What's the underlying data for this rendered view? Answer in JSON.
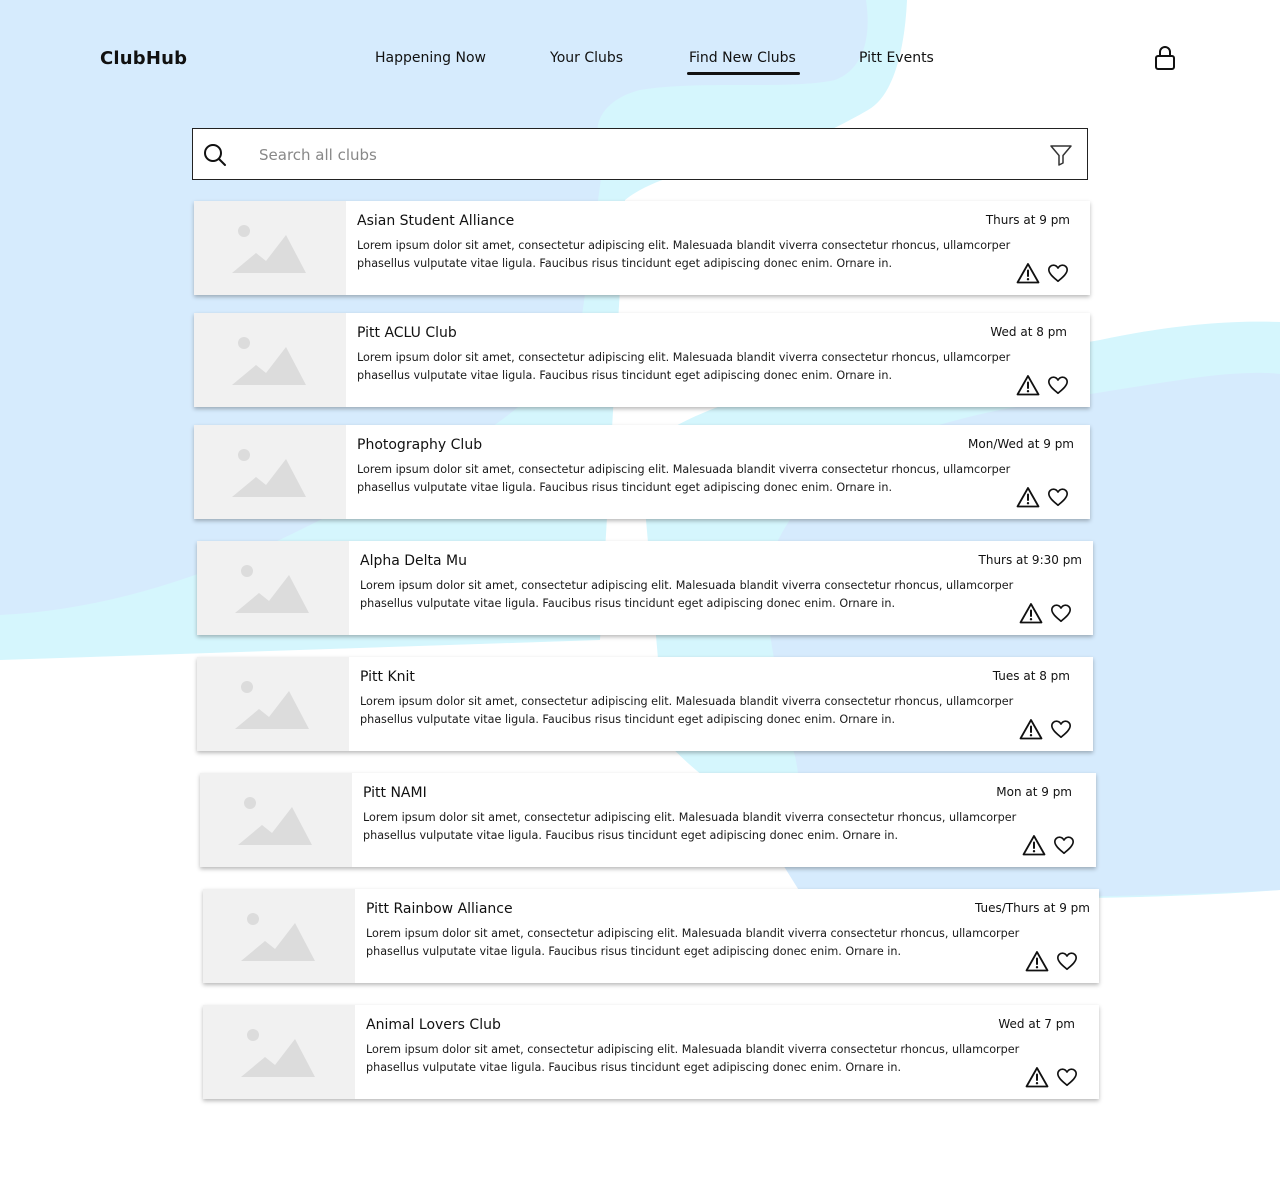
{
  "header": {
    "logo": "ClubHub",
    "nav": [
      {
        "label": "Happening Now",
        "active": false
      },
      {
        "label": "Your Clubs",
        "active": false
      },
      {
        "label": "Find New Clubs",
        "active": true
      },
      {
        "label": "Pitt Events",
        "active": false
      }
    ],
    "account_icon": "lock-icon"
  },
  "search": {
    "placeholder": "Search all clubs",
    "value": "",
    "icon": "search-icon",
    "filter_icon": "filter-icon"
  },
  "clubs": [
    {
      "name": "Asian Student Alliance",
      "meeting_time": "Thurs at 9 pm",
      "description": "Lorem ipsum dolor sit amet, consectetur adipiscing elit. Malesuada blandit viverra consectetur rhoncus, ullamcorper phasellus vulputate vitae ligula. Faucibus risus tincidunt eget adipiscing donec enim. Ornare in."
    },
    {
      "name": "Pitt ACLU Club",
      "meeting_time": "Wed at 8 pm",
      "description": "Lorem ipsum dolor sit amet, consectetur adipiscing elit. Malesuada blandit viverra consectetur rhoncus, ullamcorper phasellus vulputate vitae ligula. Faucibus risus tincidunt eget adipiscing donec enim. Ornare in."
    },
    {
      "name": "Photography Club",
      "meeting_time": "Mon/Wed at 9 pm",
      "description": "Lorem ipsum dolor sit amet, consectetur adipiscing elit. Malesuada blandit viverra consectetur rhoncus, ullamcorper phasellus vulputate vitae ligula. Faucibus risus tincidunt eget adipiscing donec enim. Ornare in."
    },
    {
      "name": "Alpha Delta Mu",
      "meeting_time": "Thurs at 9:30 pm",
      "description": "Lorem ipsum dolor sit amet, consectetur adipiscing elit. Malesuada blandit viverra consectetur rhoncus, ullamcorper phasellus vulputate vitae ligula. Faucibus risus tincidunt eget adipiscing donec enim. Ornare in."
    },
    {
      "name": "Pitt Knit",
      "meeting_time": "Tues at 8 pm",
      "description": "Lorem ipsum dolor sit amet, consectetur adipiscing elit. Malesuada blandit viverra consectetur rhoncus, ullamcorper phasellus vulputate vitae ligula. Faucibus risus tincidunt eget adipiscing donec enim. Ornare in."
    },
    {
      "name": "Pitt NAMI",
      "meeting_time": "Mon at 9 pm",
      "description": "Lorem ipsum dolor sit amet, consectetur adipiscing elit. Malesuada blandit viverra consectetur rhoncus, ullamcorper phasellus vulputate vitae ligula. Faucibus risus tincidunt eget adipiscing donec enim. Ornare in."
    },
    {
      "name": "Pitt Rainbow Alliance",
      "meeting_time": "Tues/Thurs at 9 pm",
      "description": "Lorem ipsum dolor sit amet, consectetur adipiscing elit. Malesuada blandit viverra consectetur rhoncus, ullamcorper phasellus vulputate vitae ligula. Faucibus risus tincidunt eget adipiscing donec enim. Ornare in."
    },
    {
      "name": "Animal Lovers Club",
      "meeting_time": "Wed at 7 pm",
      "description": "Lorem ipsum dolor sit amet, consectetur adipiscing elit. Malesuada blandit viverra consectetur rhoncus, ullamcorper phasellus vulputate vitae ligula. Faucibus risus tincidunt eget adipiscing donec enim. Ornare in."
    }
  ],
  "card_icons": {
    "thumbnail": "image-placeholder-icon",
    "report": "warning-icon",
    "favorite": "heart-icon"
  },
  "colors": {
    "blob_light_blue": "#d6ebfd",
    "blob_cyan": "#d5f6fd",
    "thumbnail_bg": "#f1f1f1",
    "placeholder_gray": "#dcdcdc",
    "text": "#111111"
  }
}
